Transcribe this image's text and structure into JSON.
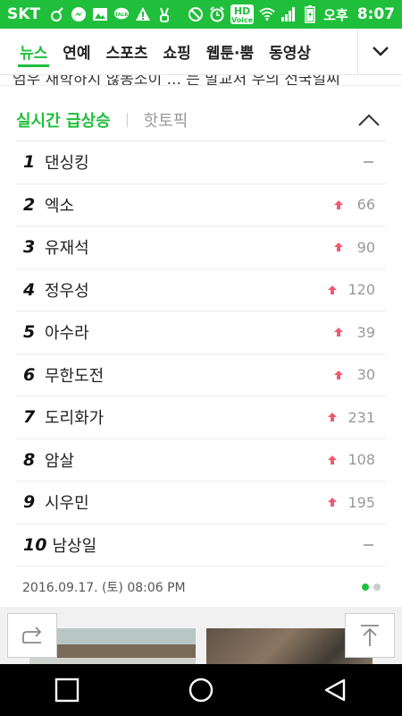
{
  "status_bar": {
    "carrier": "SKT",
    "icons_left": [
      "mood-icon",
      "messenger-icon",
      "gallery-icon",
      "talk-icon",
      "warning-icon",
      "victory-icon"
    ],
    "icons_right": [
      "block-icon",
      "alarm-icon",
      "hd-voice-icon",
      "wifi-icon",
      "signal-icon",
      "battery-icon"
    ],
    "hd_label": "HD",
    "voice_label": "Voice",
    "ampm": "오후",
    "time": "8:07",
    "bg_color": "#1fbf3b"
  },
  "tabs": [
    {
      "label": "뉴스",
      "active": true
    },
    {
      "label": "연예",
      "active": false
    },
    {
      "label": "스포츠",
      "active": false
    },
    {
      "label": "쇼핑",
      "active": false
    },
    {
      "label": "웹툰·뿜",
      "active": false
    },
    {
      "label": "동영상",
      "active": false
    }
  ],
  "peek_headline": "엄우 재학하지 않동소이 ... 는 말교처 우의  전국일씨",
  "ranking": {
    "title": "실시간 급상승",
    "secondary_tab": "핫토픽",
    "accent_color": "#1fbf3b",
    "up_color": "#f05a6e",
    "items": [
      {
        "rank": "1",
        "keyword": "댄싱킹",
        "trend": "flat",
        "value": ""
      },
      {
        "rank": "2",
        "keyword": "엑소",
        "trend": "up",
        "value": "66"
      },
      {
        "rank": "3",
        "keyword": "유재석",
        "trend": "up",
        "value": "90"
      },
      {
        "rank": "4",
        "keyword": "정우성",
        "trend": "up",
        "value": "120"
      },
      {
        "rank": "5",
        "keyword": "아수라",
        "trend": "up",
        "value": "39"
      },
      {
        "rank": "6",
        "keyword": "무한도전",
        "trend": "up",
        "value": "30"
      },
      {
        "rank": "7",
        "keyword": "도리화가",
        "trend": "up",
        "value": "231"
      },
      {
        "rank": "8",
        "keyword": "암살",
        "trend": "up",
        "value": "108"
      },
      {
        "rank": "9",
        "keyword": "시우민",
        "trend": "up",
        "value": "195"
      },
      {
        "rank": "10",
        "keyword": "남상일",
        "trend": "flat",
        "value": ""
      }
    ],
    "timestamp": "2016.09.17. (토) 08:06 PM",
    "page_dots": 2,
    "active_dot": 0
  },
  "floating": {
    "share_icon": "share-icon",
    "top_icon": "scroll-top-icon"
  },
  "nav_bar": {
    "buttons": [
      "recent-apps-icon",
      "home-icon",
      "back-icon"
    ]
  }
}
